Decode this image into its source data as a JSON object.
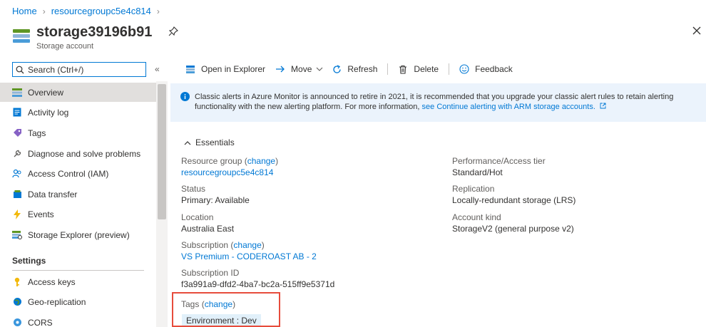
{
  "breadcrumb": {
    "home": "Home",
    "resource_group": "resourcegroupc5e4c814"
  },
  "header": {
    "title": "storage39196b91",
    "subtitle": "Storage account"
  },
  "search": {
    "placeholder": "Search (Ctrl+/)",
    "value": ""
  },
  "sidebar": {
    "items": [
      {
        "label": "Overview",
        "icon": "overview-icon"
      },
      {
        "label": "Activity log",
        "icon": "activity-log-icon"
      },
      {
        "label": "Tags",
        "icon": "tag-icon"
      },
      {
        "label": "Diagnose and solve problems",
        "icon": "wrench-icon"
      },
      {
        "label": "Access Control (IAM)",
        "icon": "people-icon"
      },
      {
        "label": "Data transfer",
        "icon": "data-transfer-icon"
      },
      {
        "label": "Events",
        "icon": "lightning-icon"
      },
      {
        "label": "Storage Explorer (preview)",
        "icon": "storage-explorer-icon"
      }
    ],
    "settings_heading": "Settings",
    "settings_items": [
      {
        "label": "Access keys",
        "icon": "key-icon"
      },
      {
        "label": "Geo-replication",
        "icon": "globe-icon"
      },
      {
        "label": "CORS",
        "icon": "cors-icon"
      }
    ]
  },
  "toolbar": {
    "open_in_explorer": "Open in Explorer",
    "move": "Move",
    "refresh": "Refresh",
    "delete": "Delete",
    "feedback": "Feedback"
  },
  "banner": {
    "text": "Classic alerts in Azure Monitor is announced to retire in 2021, it is recommended that you upgrade your classic alert rules to retain alerting functionality with the new alerting platform. For more information,",
    "link": "see Continue alerting with ARM storage accounts."
  },
  "essentials": {
    "heading": "Essentials",
    "change_label": "change",
    "left": {
      "resource_group_label": "Resource group",
      "resource_group_value": "resourcegroupc5e4c814",
      "status_label": "Status",
      "status_value": "Primary: Available",
      "location_label": "Location",
      "location_value": "Australia East",
      "subscription_label": "Subscription",
      "subscription_value": "VS Premium - CODEROAST AB - 2",
      "subscription_id_label": "Subscription ID",
      "subscription_id_value": "f3a991a9-dfd2-4ba7-bc2a-515ff9e5371d",
      "tags_label": "Tags"
    },
    "right": {
      "performance_label": "Performance/Access tier",
      "performance_value": "Standard/Hot",
      "replication_label": "Replication",
      "replication_value": "Locally-redundant storage (LRS)",
      "account_kind_label": "Account kind",
      "account_kind_value": "StorageV2 (general purpose v2)"
    },
    "tag_chip": "Environment : Dev"
  },
  "colors": {
    "accent": "#0078d4",
    "banner_bg": "#ebf3fc",
    "highlight_box": "#e74c3c",
    "active_nav": "#e1dfdd"
  }
}
